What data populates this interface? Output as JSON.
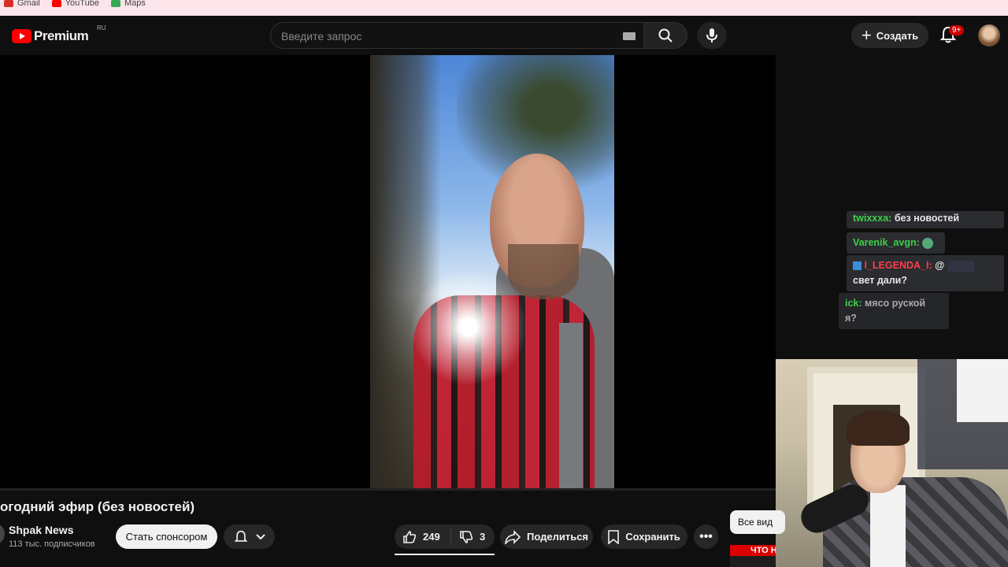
{
  "bookmarks": [
    {
      "label": "Gmail",
      "color": "#d93025"
    },
    {
      "label": "YouTube",
      "color": "#ff0000"
    },
    {
      "label": "Maps",
      "color": "#34a853"
    }
  ],
  "header": {
    "logo_text": "Premium",
    "logo_region": "RU",
    "search_placeholder": "Введите запрос",
    "create_label": "Создать",
    "notifications_badge": "9+"
  },
  "video": {
    "title": "огодний эфир (без новостей)",
    "channel_name": "Shpak News",
    "subscribers": "113 тыс. подписчиков",
    "sponsor_label": "Стать спонсором",
    "likes": "249",
    "dislikes": "3",
    "share_label": "Поделиться",
    "save_label": "Сохранить",
    "all_videos_label": "Все вид",
    "thumb_label": "ЧТО Н"
  },
  "chat": {
    "messages": [
      {
        "user": "twixxxa:",
        "text": "без новостей"
      },
      {
        "user": "Varenik_avgn:",
        "text": ""
      },
      {
        "user": "l_LEGENDA_l:",
        "text": "@",
        "text2": "свет дали?"
      },
      {
        "user": "ick:",
        "text": "мясо руской",
        "text2": "я?"
      }
    ]
  }
}
